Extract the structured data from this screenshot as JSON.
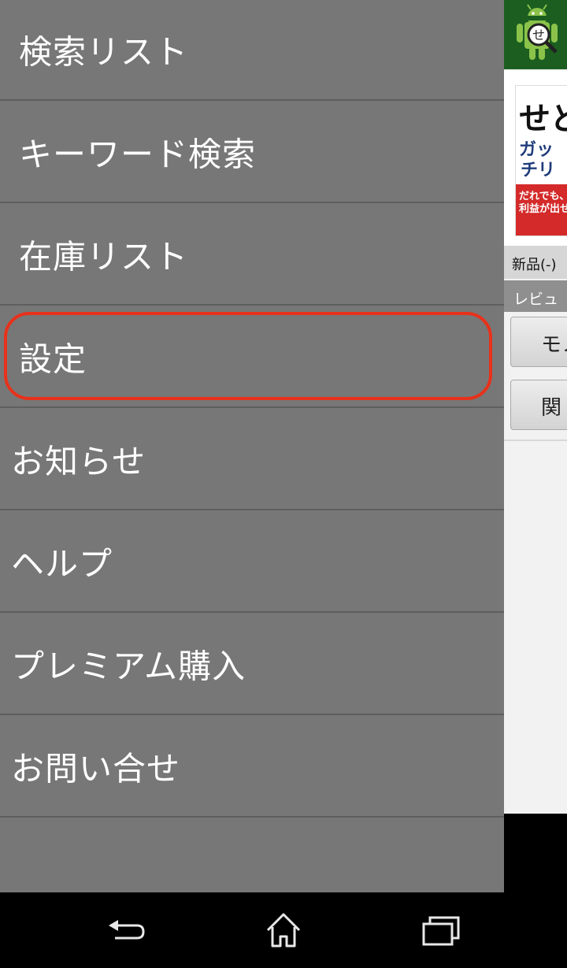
{
  "drawer": {
    "items": [
      {
        "label": "検索リスト"
      },
      {
        "label": "キーワード検索"
      },
      {
        "label": "在庫リスト"
      },
      {
        "label": "設定",
        "highlighted": true
      },
      {
        "label": "お知らせ"
      },
      {
        "label": "ヘルプ"
      },
      {
        "label": "プレミアム購入"
      },
      {
        "label": "お問い合せ"
      }
    ],
    "highlight_color": "#e8311a",
    "background_color": "#777777"
  },
  "app": {
    "header_icon": "android-search-icon",
    "book": {
      "title_fragment": "せど",
      "line2": "ガッ",
      "line3": "チリ",
      "red_line1": "だれでも、いま",
      "red_line2": "利益が出せる"
    },
    "price_text": "新品(-)",
    "review_text": "レビュ",
    "buttons": [
      {
        "label": "モノ"
      },
      {
        "label": "関"
      }
    ]
  },
  "navbar": {
    "back_icon": "back-icon",
    "home_icon": "home-icon",
    "recent_icon": "recent-apps-icon"
  }
}
